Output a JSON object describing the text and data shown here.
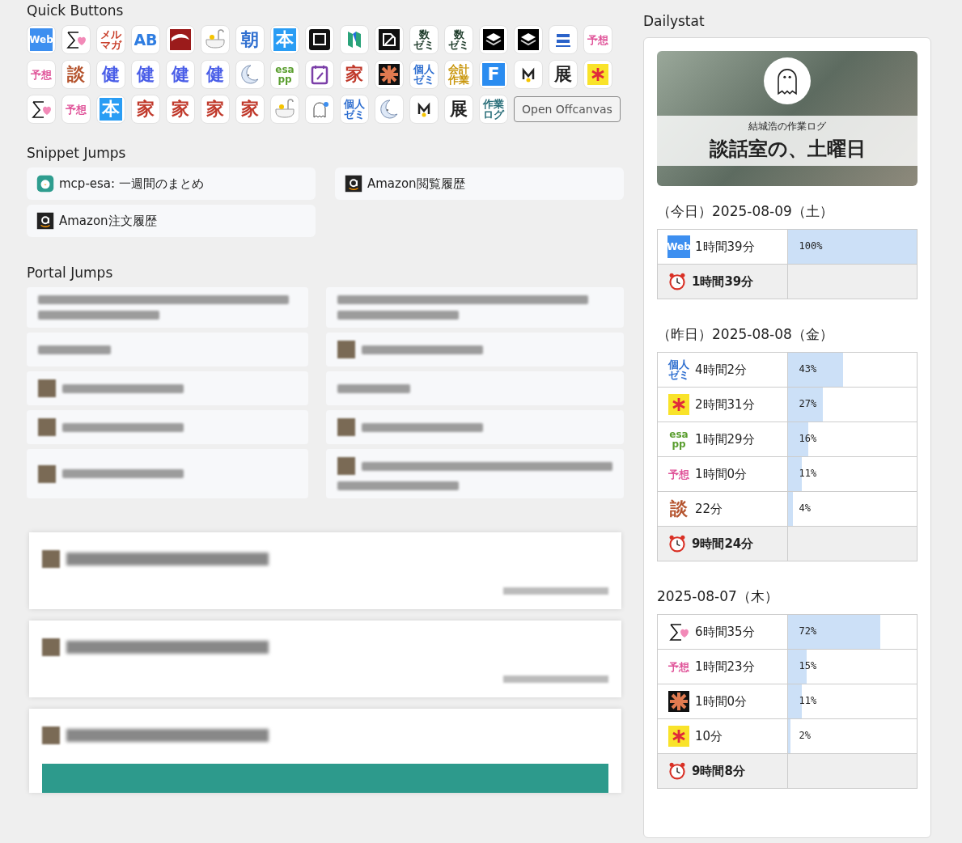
{
  "quick_buttons": {
    "title": "Quick Buttons",
    "items": [
      {
        "kind": "boxed",
        "lines": [
          "Web"
        ],
        "color": "#3d8ff0"
      },
      {
        "kind": "sigma-heart"
      },
      {
        "kind": "text",
        "lines": [
          "メル",
          "マガ"
        ],
        "color": "#c9402c"
      },
      {
        "kind": "text",
        "lines": [
          "AB"
        ],
        "color": "#2f7de1"
      },
      {
        "kind": "swoosh"
      },
      {
        "kind": "bath"
      },
      {
        "kind": "text",
        "lines": [
          "朝"
        ],
        "color": "#2f6fd0"
      },
      {
        "kind": "boxed",
        "lines": [
          "本"
        ],
        "color": "#2a9df4"
      },
      {
        "kind": "frame"
      },
      {
        "kind": "n-logo"
      },
      {
        "kind": "pencil-dark"
      },
      {
        "kind": "text",
        "lines": [
          "数",
          "ゼミ"
        ],
        "color": "#1d3b2a"
      },
      {
        "kind": "text",
        "lines": [
          "数",
          "ゼミ"
        ],
        "color": "#1d3b2a"
      },
      {
        "kind": "layers"
      },
      {
        "kind": "layers"
      },
      {
        "kind": "newsletter"
      },
      {
        "kind": "text",
        "lines": [
          "予想"
        ],
        "color": "#e0559a"
      },
      {
        "kind": "text",
        "lines": [
          "予想"
        ],
        "color": "#e0559a"
      },
      {
        "kind": "text",
        "lines": [
          "談"
        ],
        "color": "#b5542e"
      },
      {
        "kind": "text",
        "lines": [
          "健"
        ],
        "color": "#4a5ee8"
      },
      {
        "kind": "text",
        "lines": [
          "健"
        ],
        "color": "#4a5ee8"
      },
      {
        "kind": "text",
        "lines": [
          "健"
        ],
        "color": "#4a5ee8"
      },
      {
        "kind": "text",
        "lines": [
          "健"
        ],
        "color": "#4a5ee8"
      },
      {
        "kind": "moon"
      },
      {
        "kind": "text",
        "lines": [
          "esa",
          "pp"
        ],
        "color": "#5a9e2f"
      },
      {
        "kind": "notepad"
      },
      {
        "kind": "text",
        "lines": [
          "家"
        ],
        "color": "#c0392b"
      },
      {
        "kind": "burst"
      },
      {
        "kind": "text",
        "lines": [
          "個人",
          "ゼミ"
        ],
        "color": "#2f6fd0"
      },
      {
        "kind": "text",
        "lines": [
          "会計",
          "作業"
        ],
        "color": "#c9960c"
      },
      {
        "kind": "boxed",
        "lines": [
          "F"
        ],
        "color": "#2a8cf0"
      },
      {
        "kind": "m-logo"
      },
      {
        "kind": "text",
        "lines": [
          "展"
        ],
        "color": "#222222"
      },
      {
        "kind": "asterisk"
      },
      {
        "kind": "sigma-heart"
      },
      {
        "kind": "text",
        "lines": [
          "予想"
        ],
        "color": "#e0559a"
      },
      {
        "kind": "boxed",
        "lines": [
          "本"
        ],
        "color": "#2a9df4"
      },
      {
        "kind": "text",
        "lines": [
          "家"
        ],
        "color": "#c0392b"
      },
      {
        "kind": "text",
        "lines": [
          "家"
        ],
        "color": "#c0392b"
      },
      {
        "kind": "text",
        "lines": [
          "家"
        ],
        "color": "#c0392b"
      },
      {
        "kind": "text",
        "lines": [
          "家"
        ],
        "color": "#c0392b"
      },
      {
        "kind": "bath"
      },
      {
        "kind": "ghost"
      },
      {
        "kind": "text",
        "lines": [
          "個人",
          "ゼミ"
        ],
        "color": "#2f6fd0"
      },
      {
        "kind": "moon"
      },
      {
        "kind": "m-logo"
      },
      {
        "kind": "text",
        "lines": [
          "展"
        ],
        "color": "#222222"
      },
      {
        "kind": "text",
        "lines": [
          "作業",
          "ログ"
        ],
        "color": "#2a6f7a"
      }
    ],
    "offcanvas_button": "Open Offcanvas"
  },
  "snippet_jumps": {
    "title": "Snippet Jumps",
    "items": [
      {
        "kind": "esa",
        "label": "mcp-esa: 一週間のまとめ"
      },
      {
        "kind": "amazon",
        "label": "Amazon閲覧履歴"
      },
      {
        "kind": "amazon",
        "label": "Amazon注文履歴"
      }
    ]
  },
  "portal_jumps": {
    "title": "Portal Jumps",
    "items": [
      {
        "kind": "two-line"
      },
      {
        "kind": "two-line"
      },
      {
        "kind": "one-line"
      },
      {
        "kind": "icon-one-line"
      },
      {
        "kind": "icon-one-line"
      },
      {
        "kind": "one-line"
      },
      {
        "kind": "icon-one-line"
      },
      {
        "kind": "icon-one-line"
      },
      {
        "kind": "icon-one-line"
      },
      {
        "kind": "icon-two-line"
      }
    ]
  },
  "feed_cards": [
    {
      "kind": "note"
    },
    {
      "kind": "note"
    },
    {
      "kind": "banner"
    }
  ],
  "dailystat": {
    "title": "Dailystat",
    "banner": {
      "subtitle": "結城浩の作業ログ",
      "title": "談話室の、土曜日"
    },
    "days": [
      {
        "label": "（今日）2025-08-09（土）",
        "rows": [
          {
            "icon": {
              "kind": "boxed",
              "lines": [
                "Web"
              ],
              "color": "#3d8ff0"
            },
            "duration": "1時間39分",
            "percent": "100%",
            "level": 1
          }
        ],
        "total": "1時間39分"
      },
      {
        "label": "（昨日）2025-08-08（金）",
        "rows": [
          {
            "icon": {
              "kind": "text",
              "lines": [
                "個人",
                "ゼミ"
              ],
              "color": "#2f6fd0"
            },
            "duration": "4時間2分",
            "percent": "43%",
            "level": 0.43
          },
          {
            "icon": {
              "kind": "asterisk"
            },
            "duration": "2時間31分",
            "percent": "27%",
            "level": 0.27
          },
          {
            "icon": {
              "kind": "text",
              "lines": [
                "esa",
                "pp"
              ],
              "color": "#5a9e2f"
            },
            "duration": "1時間29分",
            "percent": "16%",
            "level": 0.16
          },
          {
            "icon": {
              "kind": "text",
              "lines": [
                "予想"
              ],
              "color": "#e0559a"
            },
            "duration": "1時間0分",
            "percent": "11%",
            "level": 0.11
          },
          {
            "icon": {
              "kind": "text",
              "lines": [
                "談"
              ],
              "color": "#b5542e"
            },
            "duration": "22分",
            "percent": "4%",
            "level": 0.04
          }
        ],
        "total": "9時間24分"
      },
      {
        "label": "2025-08-07（木）",
        "rows": [
          {
            "icon": {
              "kind": "sigma-heart"
            },
            "duration": "6時間35分",
            "percent": "72%",
            "level": 0.72
          },
          {
            "icon": {
              "kind": "text",
              "lines": [
                "予想"
              ],
              "color": "#e0559a"
            },
            "duration": "1時間23分",
            "percent": "15%",
            "level": 0.15
          },
          {
            "icon": {
              "kind": "burst"
            },
            "duration": "1時間0分",
            "percent": "11%",
            "level": 0.11
          },
          {
            "icon": {
              "kind": "asterisk"
            },
            "duration": "10分",
            "percent": "2%",
            "level": 0.02
          }
        ],
        "total": "9時間8分"
      }
    ]
  }
}
